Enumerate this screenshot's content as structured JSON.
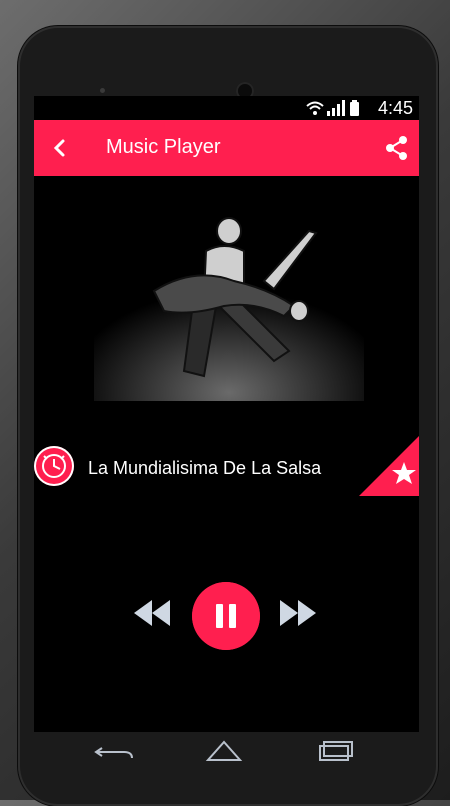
{
  "status": {
    "time": "4:45"
  },
  "appbar": {
    "title": "Music Player"
  },
  "track": {
    "title": "La Mundialisima De La Salsa"
  },
  "colors": {
    "accent": "#ff1f4f",
    "background": "#000000"
  },
  "icons": {
    "back": "arrow-left-icon",
    "share": "share-icon",
    "clock": "clock-icon",
    "star": "star-icon",
    "rewind": "rewind-icon",
    "pause": "pause-icon",
    "forward": "fast-forward-icon"
  }
}
